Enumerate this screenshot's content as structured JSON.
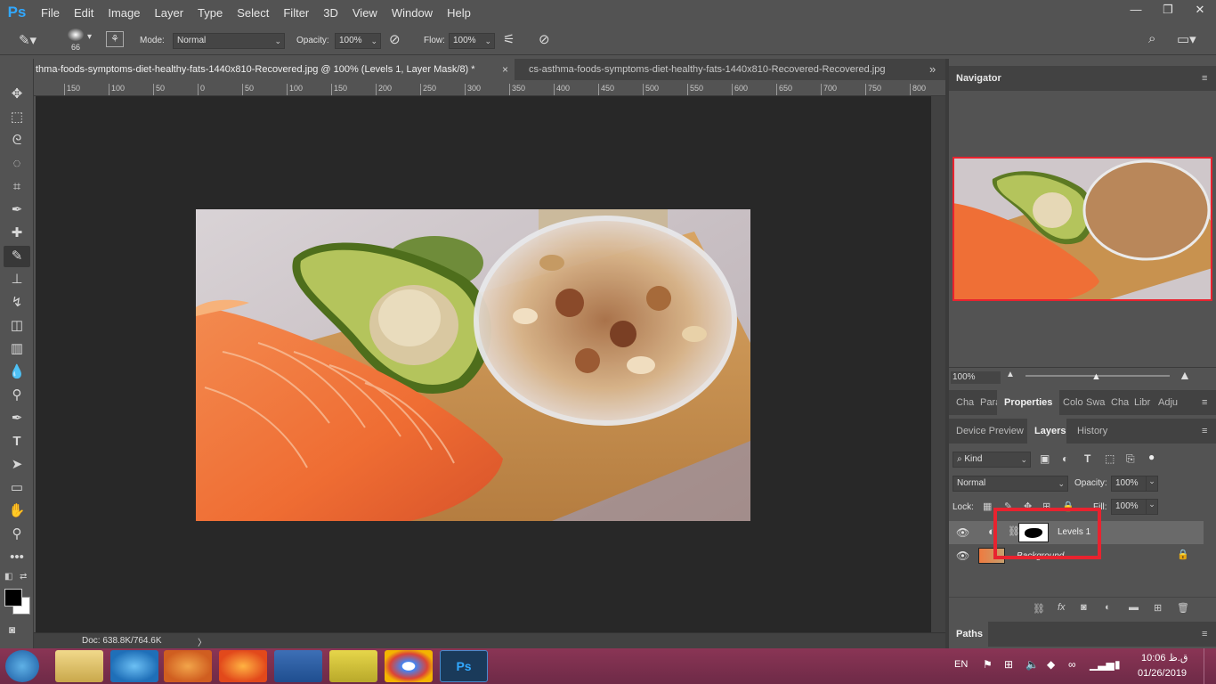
{
  "app": {
    "logo": "Ps"
  },
  "menu": [
    "File",
    "Edit",
    "Image",
    "Layer",
    "Type",
    "Select",
    "Filter",
    "3D",
    "View",
    "Window",
    "Help"
  ],
  "window_controls": {
    "minimize": "—",
    "restore": "❐",
    "close": "✕"
  },
  "options": {
    "brush_size": "66",
    "mode_label": "Mode:",
    "mode_value": "Normal",
    "opacity_label": "Opacity:",
    "opacity_value": "100%",
    "flow_label": "Flow:",
    "flow_value": "100%"
  },
  "tabs": [
    {
      "label": "thma-foods-symptoms-diet-healthy-fats-1440x810-Recovered.jpg @ 100% (Levels 1, Layer Mask/8) *",
      "close": "×"
    },
    {
      "label": "cs-asthma-foods-symptoms-diet-healthy-fats-1440x810-Recovered-Recovered.jpg"
    }
  ],
  "tab_overflow": "»",
  "ruler": [
    "150",
    "100",
    "50",
    "0",
    "50",
    "100",
    "150",
    "200",
    "250",
    "300",
    "350",
    "400",
    "450",
    "500",
    "550",
    "600",
    "650",
    "700",
    "750",
    "800"
  ],
  "status": {
    "doc": "Doc: 638.8K/764.6K",
    "arrow": "〉"
  },
  "navigator": {
    "title": "Navigator",
    "zoom": "100%"
  },
  "panel_group1": {
    "tabs": [
      "Cha",
      "Para",
      "Properties",
      "Colo",
      "Swa",
      "Cha",
      "Libr",
      "Adju"
    ]
  },
  "panel_group2": {
    "tabs": [
      "Device Preview",
      "Layers",
      "History"
    ]
  },
  "layers": {
    "filter_kind": "Kind",
    "blend_mode": "Normal",
    "opacity_label": "Opacity:",
    "opacity_value": "100%",
    "lock_label": "Lock:",
    "fill_label": "Fill:",
    "fill_value": "100%",
    "items": [
      {
        "name": "Levels 1"
      },
      {
        "name": "Background"
      }
    ]
  },
  "paths": {
    "title": "Paths"
  },
  "taskbar": {
    "lang": "EN",
    "time": "10:06 ق.ظ",
    "date": "01/26/2019",
    "ps_label": "Ps"
  },
  "colors": {
    "ps_blue": "#31a8ff",
    "highlight_red": "#e8232f",
    "taskbar": "#7b2f4e"
  }
}
